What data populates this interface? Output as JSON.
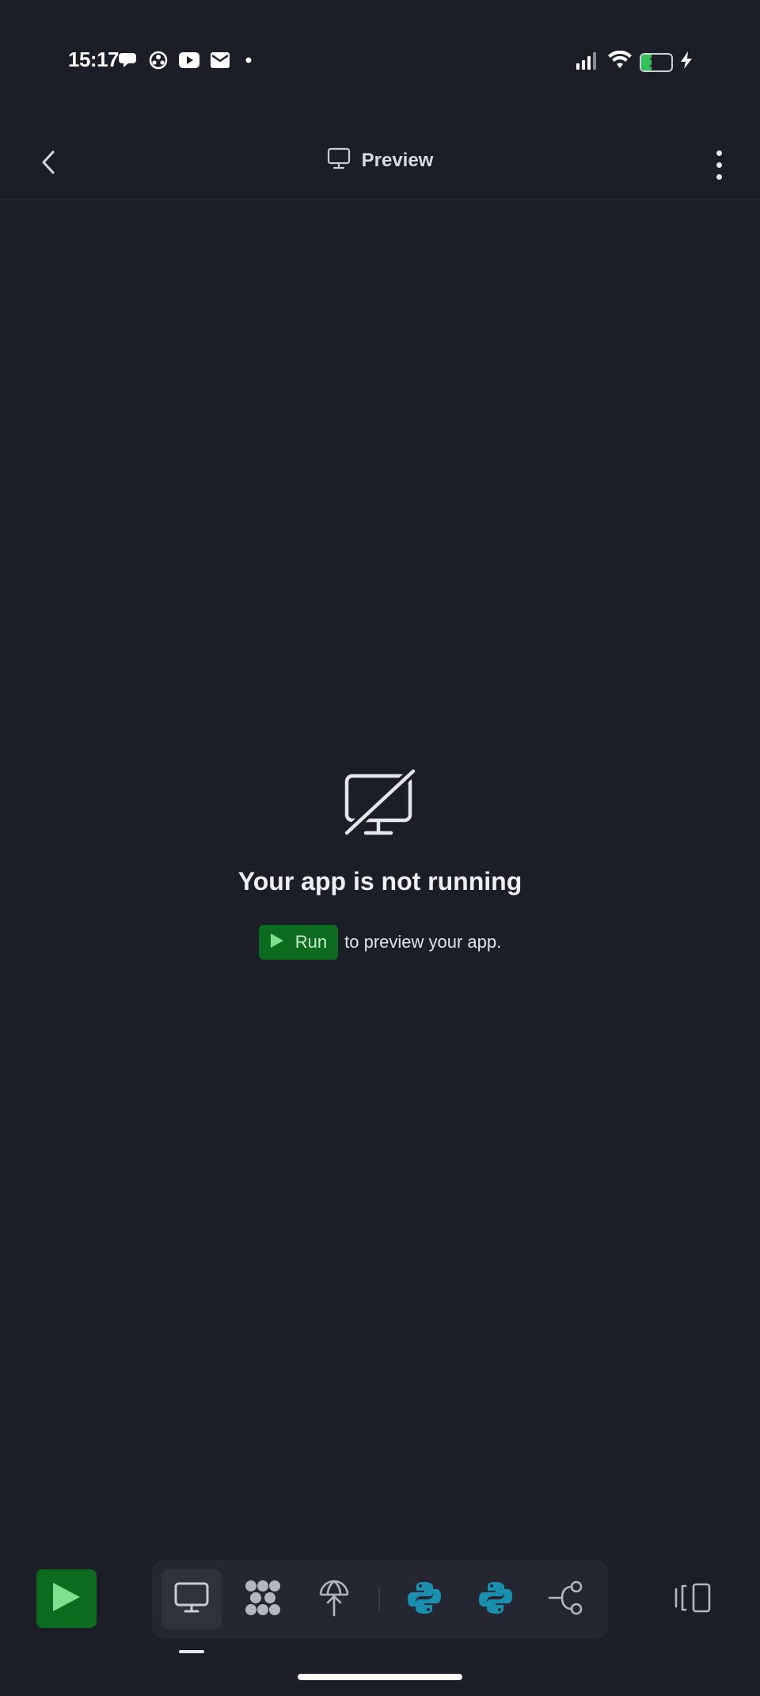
{
  "status_bar": {
    "time": "15:17",
    "battery_level": "16",
    "battery_fraction": 0.16,
    "notification_icons": [
      "chat-bubble-icon",
      "soccer-ball-icon",
      "youtube-icon",
      "mail-icon",
      "dot-icon"
    ]
  },
  "header": {
    "title": "Preview",
    "icon": "monitor-icon"
  },
  "empty_state": {
    "icon": "monitor-off-icon",
    "title": "Your app is not running",
    "run_label": "Run",
    "suffix": "to preview your app."
  },
  "toolbar": {
    "tools": [
      {
        "name": "preview",
        "icon": "monitor-icon",
        "active": true
      },
      {
        "name": "agent",
        "icon": "agent-cluster-icon",
        "active": false
      },
      {
        "name": "deploy",
        "icon": "deploy-parachute-icon",
        "active": false
      },
      {
        "name": "python-file-1",
        "icon": "python-icon",
        "active": false
      },
      {
        "name": "python-file-2",
        "icon": "python-icon",
        "active": false
      },
      {
        "name": "git",
        "icon": "git-branch-icon",
        "active": false
      }
    ]
  },
  "colors": {
    "background": "#1b1e27",
    "run_green": "#0d6b20",
    "run_play": "#7fe08f",
    "python_teal": "#1a8fb0",
    "battery_green": "#35c05a"
  }
}
